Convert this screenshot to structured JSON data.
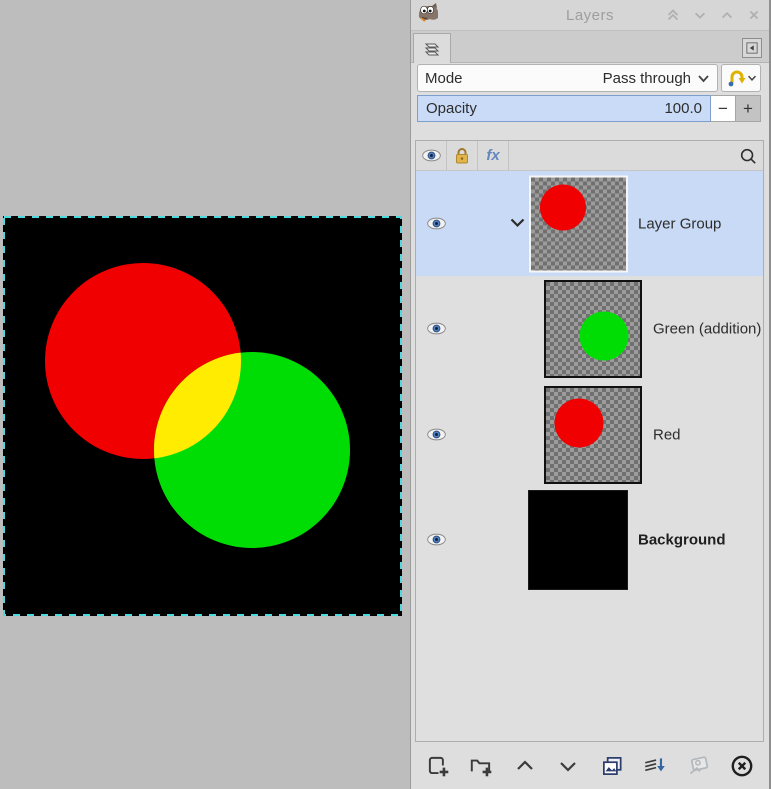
{
  "window": {
    "title": "Layers"
  },
  "titlebar": {
    "buttons": [
      "collapse-dock",
      "shade-down",
      "shade-up",
      "close"
    ]
  },
  "dock": {
    "active_tab": "layers",
    "tab_menu_icon": "left-triangle"
  },
  "mode": {
    "label": "Mode",
    "value": "Pass through"
  },
  "opacity": {
    "label": "Opacity",
    "value": "100.0",
    "minus": "−",
    "plus": "+"
  },
  "list_header": {
    "icons": [
      "visibility-eye",
      "lock",
      "effects",
      "search"
    ],
    "effects_label": "fx"
  },
  "layers": [
    {
      "name": "Layer Group",
      "type": "group",
      "visible": true,
      "selected": true,
      "expanded": true
    },
    {
      "name": "Green (addition)",
      "type": "layer",
      "visible": true,
      "child_of_group": true
    },
    {
      "name": "Red",
      "type": "layer",
      "visible": true,
      "child_of_group": true
    },
    {
      "name": "Background",
      "type": "layer",
      "visible": true,
      "bold": true
    }
  ],
  "toolbar": {
    "buttons": [
      "new-layer",
      "new-layer-group",
      "raise-layer",
      "lower-layer",
      "duplicate-layer",
      "merge-down",
      "anchor-layer",
      "delete-layer"
    ],
    "anchor_disabled": true
  },
  "canvas": {
    "background": "#000000",
    "boundary_dash_color": "#4fd9e1",
    "red_circle_color": "#f00000",
    "green_circle_color": "#00dd04",
    "overlap_color": "#ffec00"
  },
  "colors": {
    "selected_row": "#c8daf5",
    "opacity_slider_fill": "#c9dbf7",
    "panel_background": "#dedede",
    "desktop_background": "#bdbdbd",
    "merge_arrow_blue": "#3465a4",
    "lock_gold": "#e2b44c"
  }
}
